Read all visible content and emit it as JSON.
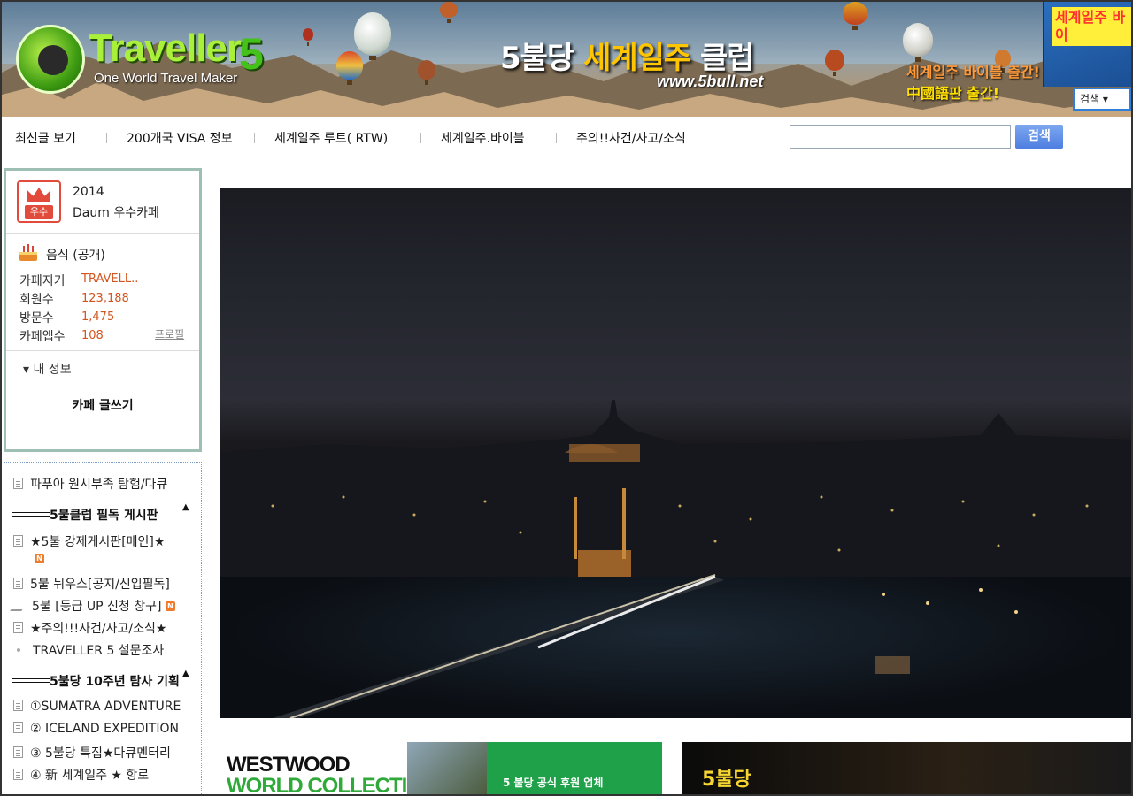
{
  "banner": {
    "logo_word": "Traveller",
    "logo_number": "5",
    "logo_tagline": "One World Travel Maker",
    "title_prefix": "5불당",
    "title_accent": "세계일주",
    "title_suffix": "클럽",
    "url": "www.5bull.net",
    "promo_line1": "세계일주 바이블 출간!",
    "promo_line2": "中國語판 출간!",
    "book_title": "세계일주 바이",
    "search_label": "검색 ▾"
  },
  "nav": {
    "items": [
      "최신글 보기",
      "200개국 VISA 정보",
      "세계일주 루트( RTW)",
      "세계일주.바이블",
      "주의!!사건/사고/소식"
    ],
    "search_placeholder": "",
    "search_button": "검색"
  },
  "profile": {
    "badge_text": "우수",
    "award_year": "2014",
    "award_name": "Daum 우수카페",
    "category": "음식 (공개)",
    "stats": [
      {
        "label": "카페지기",
        "value": "TRAVELL.."
      },
      {
        "label": "회원수",
        "value": "123,188"
      },
      {
        "label": "방문수",
        "value": "1,475"
      },
      {
        "label": "카페앱수",
        "value": "108"
      }
    ],
    "profile_link": "프로필",
    "my_info": "▾ 내 정보",
    "write_button": "카페 글쓰기"
  },
  "menu": {
    "items": [
      {
        "label": "파푸아 원시부족 탐험/다큐",
        "icon": "board-icon",
        "new": false
      },
      {
        "label": "5불클럽 필독 게시판",
        "type": "header"
      },
      {
        "label": "★5불 강제게시판[메인]★",
        "icon": "board-icon",
        "new": true
      },
      {
        "label": "5불 뉘우스[공지/신입필독]",
        "icon": "board-icon",
        "new": false
      },
      {
        "label": "5불 [등급 UP 신청 창구]",
        "icon": "pencil-icon",
        "new": true
      },
      {
        "label": "★주의!!!사건/사고/소식★",
        "icon": "board-icon",
        "new": false
      },
      {
        "label": "TRAVELLER 5 설문조사",
        "icon": "dot-icon",
        "new": false
      },
      {
        "label": "5불당 10주년 탐사 기획",
        "type": "header"
      },
      {
        "label": "①SUMATRA ADVENTURE",
        "icon": "board-icon",
        "new": false
      },
      {
        "label": "② ICELAND EXPEDITION",
        "icon": "board-icon",
        "new": false
      },
      {
        "label": "③ 5불당 특집★다큐멘터리",
        "icon": "board-icon",
        "new": false
      },
      {
        "label": "④ 新 세계일주 ★ 항로",
        "icon": "board-icon",
        "new": false
      }
    ],
    "new_badge": "N"
  },
  "ads": {
    "ad1_line1": "WESTWOOD",
    "ad1_line2": "WORLD COLLECTION",
    "ad1_sponsor": "5 불당 공식 후원 업체",
    "ad2_title": "5불당"
  }
}
